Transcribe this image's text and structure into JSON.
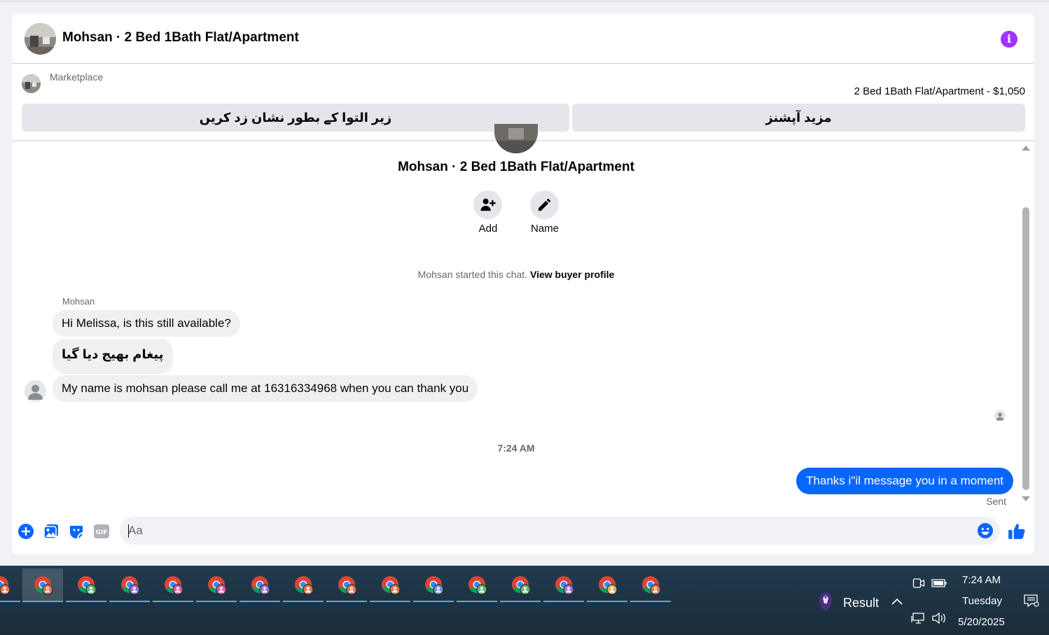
{
  "header": {
    "title": "Mohsan · 2 Bed 1Bath Flat/Apartment"
  },
  "marketplace": {
    "label": "Marketplace",
    "listing": "2 Bed 1Bath Flat/Apartment - $1,050",
    "btn_snooze": "زیر التوا کے بطور نشان زد کریں",
    "btn_more_options": "مزید آپشنز"
  },
  "thread": {
    "title": "Mohsan · 2 Bed 1Bath Flat/Apartment",
    "add_label": "Add",
    "name_label": "Name",
    "started_text": "Mohsan started this chat.",
    "buyer_profile_link": "View buyer profile",
    "sender_name": "Mohsan",
    "messages_in": [
      "Hi Melissa, is this still available?",
      "پیغام بھیج دیا گیا",
      "My name is mohsan please call me at 16316334968  when you can thank you"
    ],
    "timestamp": "7:24 AM",
    "message_out": "Thanks i\"il message you in a moment",
    "status": "Sent"
  },
  "composer": {
    "placeholder": "Aa"
  },
  "taskbar": {
    "result_label": "Result",
    "time": "7:24 AM",
    "day": "Tuesday",
    "date": "5/20/2025",
    "badge_colors": [
      "#e8734a",
      "#e8734a",
      "#5fb56b",
      "#9b6bd6",
      "#e0569a",
      "#e0569a",
      "#9b6bd6",
      "#e8734a",
      "#e8734a",
      "#e8734a",
      "#6b8fd6",
      "#5fb56b",
      "#5fb56b",
      "#9b6bd6",
      "#d6b45a",
      "#e8734a"
    ]
  },
  "colors": {
    "accent": "#0866ff",
    "info": "#a033ff"
  }
}
